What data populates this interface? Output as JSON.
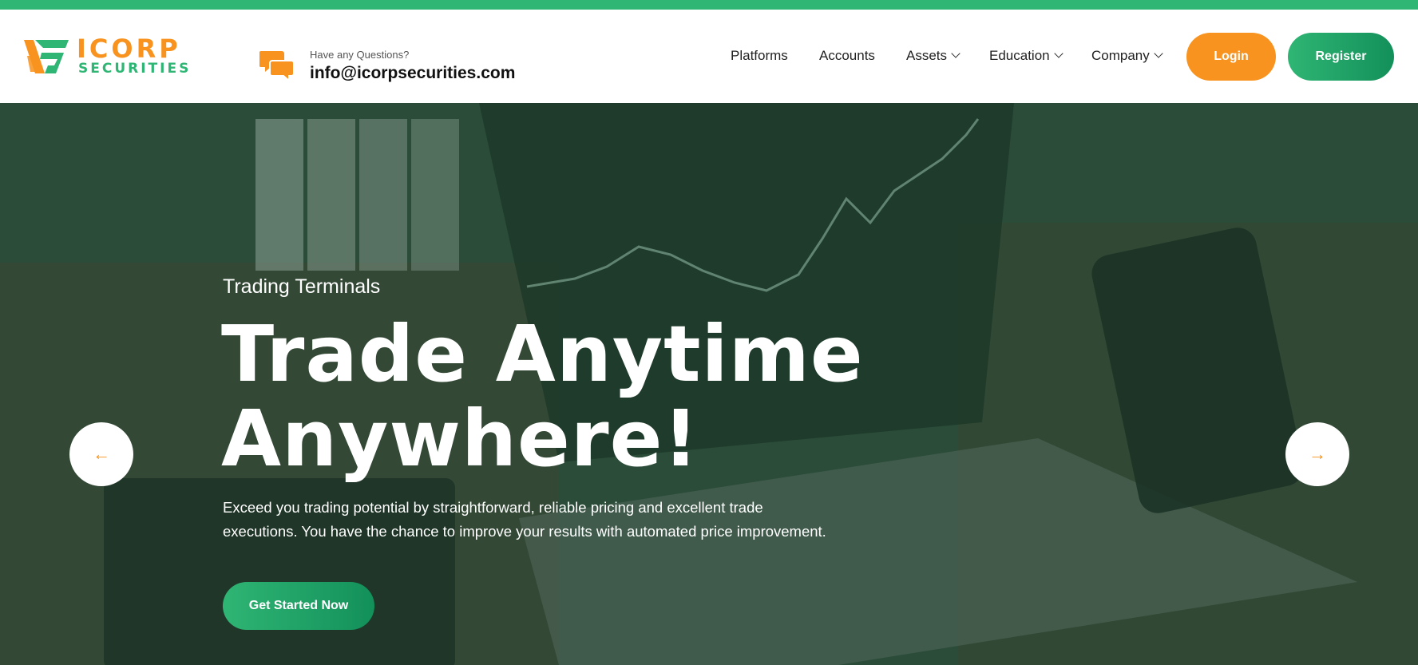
{
  "brand": {
    "word1": "ICORP",
    "word2": "SECURITIES",
    "colors": {
      "green": "#2fb574",
      "orange": "#f7931e"
    }
  },
  "contact": {
    "question": "Have any Questions?",
    "email": "info@icorpsecurities.com",
    "icon": "chat-bubbles-icon"
  },
  "nav": {
    "items": [
      {
        "label": "Platforms",
        "dropdown": false
      },
      {
        "label": "Accounts",
        "dropdown": false
      },
      {
        "label": "Assets",
        "dropdown": true
      },
      {
        "label": "Education",
        "dropdown": true
      },
      {
        "label": "Company",
        "dropdown": true
      }
    ],
    "login": "Login",
    "register": "Register"
  },
  "hero": {
    "subtitle": "Trading Terminals",
    "title_line1": "Trade Anytime",
    "title_line2": "Anywhere!",
    "description": "Exceed you trading potential by straightforward, reliable pricing and excellent trade executions. You have the chance to improve your results with automated price improvement.",
    "cta": "Get Started Now",
    "prev_icon": "arrow-left-icon",
    "next_icon": "arrow-right-icon"
  }
}
